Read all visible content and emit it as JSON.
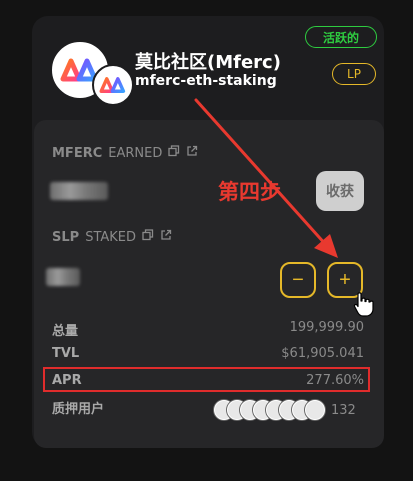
{
  "pool": {
    "name": "莫比社区(Mferc)",
    "pair": "mferc-eth-staking",
    "status_badge": "活跃的",
    "type_badge": "LP"
  },
  "earned": {
    "token": "MFERC",
    "label": "EARNED",
    "harvest_label": "收获"
  },
  "staked": {
    "token": "SLP",
    "label": "STAKED",
    "minus_label": "−",
    "plus_label": "+"
  },
  "annotation": {
    "step_text": "第四步"
  },
  "stats": {
    "total_label": "总量",
    "total_value": "199,999.90",
    "tvl_label": "TVL",
    "tvl_value": "$61,905.041",
    "apr_label": "APR",
    "apr_value": "277.60%",
    "stakers_label": "质押用户",
    "stakers_count": "132"
  },
  "colors": {
    "accent_gold": "#e5b829",
    "active_green": "#2ecc40",
    "annotation_red": "#e8392f"
  },
  "icons": [
    "copy-icon",
    "external-link-icon",
    "hand-cursor-icon",
    "mferc-logo-icon",
    "eth-logo-icon"
  ]
}
